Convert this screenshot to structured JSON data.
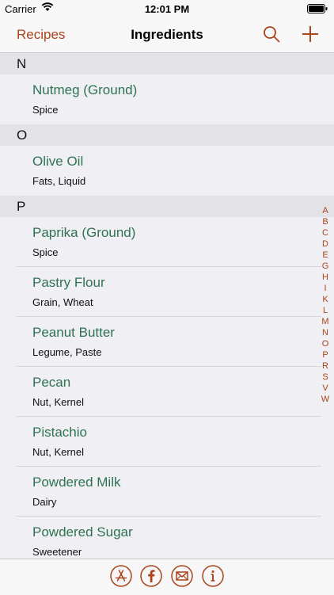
{
  "status_bar": {
    "carrier": "Carrier",
    "time": "12:01 PM"
  },
  "nav": {
    "back_label": "Recipes",
    "title": "Ingredients",
    "search_icon": "search-icon",
    "add_icon": "plus-icon"
  },
  "sections": [
    {
      "letter": "N",
      "items": [
        {
          "name": "Nutmeg (Ground)",
          "detail": "Spice"
        }
      ]
    },
    {
      "letter": "O",
      "items": [
        {
          "name": "Olive Oil",
          "detail": "Fats, Liquid"
        }
      ]
    },
    {
      "letter": "P",
      "items": [
        {
          "name": "Paprika (Ground)",
          "detail": "Spice"
        },
        {
          "name": "Pastry Flour",
          "detail": "Grain, Wheat"
        },
        {
          "name": "Peanut Butter",
          "detail": "Legume, Paste"
        },
        {
          "name": "Pecan",
          "detail": "Nut, Kernel"
        },
        {
          "name": "Pistachio",
          "detail": "Nut, Kernel"
        },
        {
          "name": "Powdered Milk",
          "detail": "Dairy"
        },
        {
          "name": "Powdered Sugar",
          "detail": "Sweetener"
        }
      ]
    }
  ],
  "index_letters": [
    "A",
    "B",
    "C",
    "D",
    "E",
    "G",
    "H",
    "I",
    "K",
    "L",
    "M",
    "N",
    "O",
    "P",
    "R",
    "S",
    "V",
    "W"
  ],
  "toolbar": {
    "icons": [
      "app-store-icon",
      "facebook-icon",
      "mail-icon",
      "info-icon"
    ]
  },
  "colors": {
    "accent": "#a9441b",
    "item_green": "#2f7352"
  }
}
